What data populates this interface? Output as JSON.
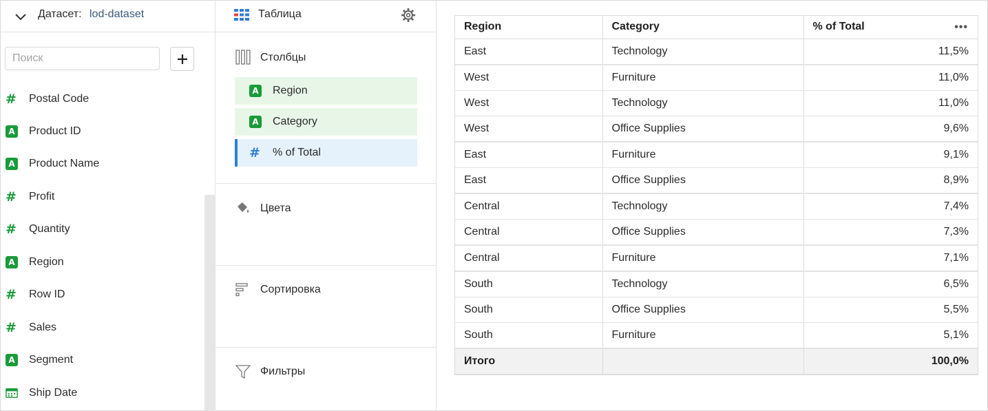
{
  "dataset": {
    "label": "Датасет:",
    "name": "lod-dataset",
    "search_placeholder": "Поиск",
    "fields": [
      {
        "type": "measure",
        "label": "Postal Code",
        "icon": "hash-icon"
      },
      {
        "type": "dimension",
        "label": "Product ID",
        "icon": "string-a-icon"
      },
      {
        "type": "dimension",
        "label": "Product Name",
        "icon": "string-a-icon"
      },
      {
        "type": "measure",
        "label": "Profit",
        "icon": "hash-icon"
      },
      {
        "type": "measure",
        "label": "Quantity",
        "icon": "hash-icon"
      },
      {
        "type": "dimension",
        "label": "Region",
        "icon": "string-a-icon"
      },
      {
        "type": "measure",
        "label": "Row ID",
        "icon": "hash-icon"
      },
      {
        "type": "measure",
        "label": "Sales",
        "icon": "hash-icon"
      },
      {
        "type": "dimension",
        "label": "Segment",
        "icon": "string-a-icon"
      },
      {
        "type": "date",
        "label": "Ship Date",
        "icon": "calendar-icon"
      }
    ]
  },
  "visualization": {
    "title": "Таблица",
    "sections": {
      "columns": {
        "title": "Столбцы",
        "chips": [
          {
            "label": "Region",
            "icon": "string-a-icon"
          },
          {
            "label": "Category",
            "icon": "string-a-icon"
          },
          {
            "label": "% of Total",
            "icon": "hash-icon"
          }
        ]
      },
      "colors": {
        "title": "Цвета"
      },
      "sort": {
        "title": "Сортировка"
      },
      "filters": {
        "title": "Фильтры"
      }
    }
  },
  "table": {
    "headers": [
      "Region",
      "Category",
      "% of Total"
    ],
    "rows": [
      [
        "East",
        "Technology",
        "11,5%"
      ],
      [
        "West",
        "Furniture",
        "11,0%"
      ],
      [
        "West",
        "Technology",
        "11,0%"
      ],
      [
        "West",
        "Office Supplies",
        "9,6%"
      ],
      [
        "East",
        "Furniture",
        "9,1%"
      ],
      [
        "East",
        "Office Supplies",
        "8,9%"
      ],
      [
        "Central",
        "Technology",
        "7,4%"
      ],
      [
        "Central",
        "Office Supplies",
        "7,3%"
      ],
      [
        "Central",
        "Furniture",
        "7,1%"
      ],
      [
        "South",
        "Technology",
        "6,5%"
      ],
      [
        "South",
        "Office Supplies",
        "5,5%"
      ],
      [
        "South",
        "Furniture",
        "5,1%"
      ]
    ],
    "total": {
      "label": "Итого",
      "value": "100,0%"
    }
  },
  "colors": {
    "dimension": "#1a9b3a",
    "measure_chip": "#2f7ed8",
    "dimension_chip_bg": "#e8f6e8",
    "measure_chip_bg": "#e5f1fb"
  }
}
